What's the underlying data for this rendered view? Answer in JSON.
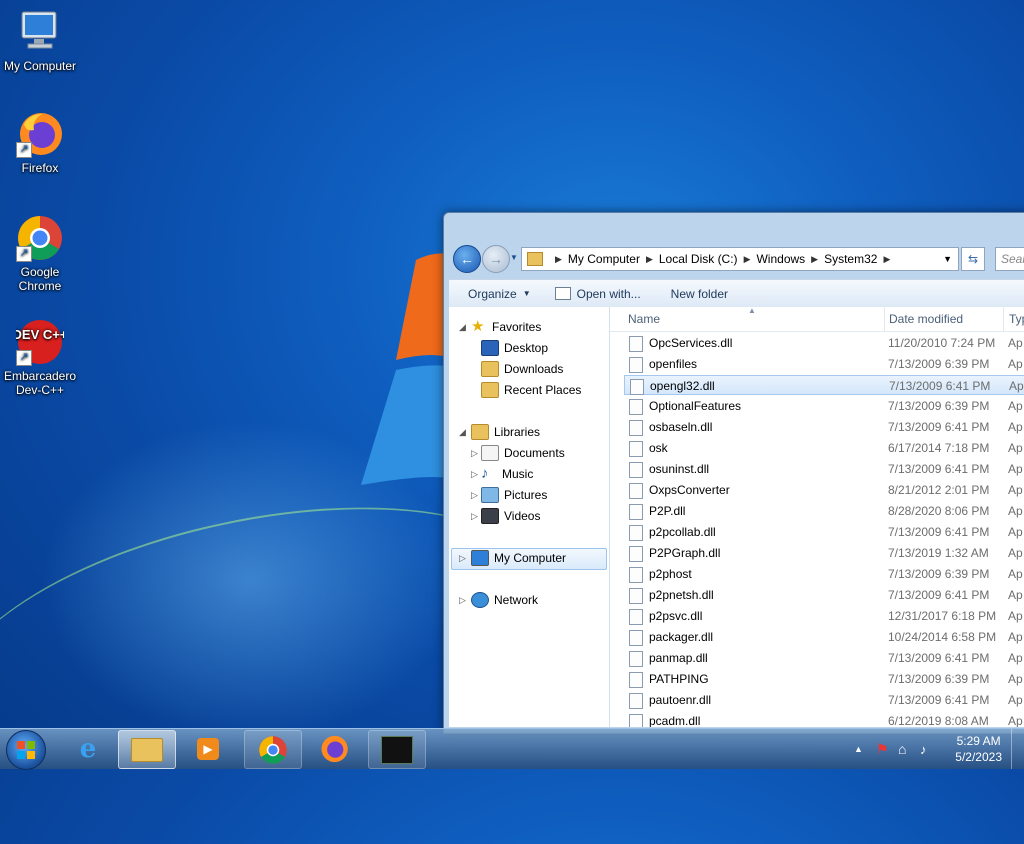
{
  "desktop": {
    "icons": [
      {
        "label": "My Computer"
      },
      {
        "label": "Firefox"
      },
      {
        "label": "Google Chrome"
      },
      {
        "label": "Embarcadero Dev-C++"
      }
    ],
    "devcpp_logo": "DEV C++"
  },
  "explorer": {
    "breadcrumb": [
      "My Computer",
      "Local Disk (C:)",
      "Windows",
      "System32"
    ],
    "search_placeholder": "Sear",
    "toolbar": {
      "organize": "Organize",
      "open_with": "Open with...",
      "new_folder": "New folder"
    },
    "nav": {
      "favorites": "Favorites",
      "desktop": "Desktop",
      "downloads": "Downloads",
      "recent": "Recent Places",
      "libraries": "Libraries",
      "documents": "Documents",
      "music": "Music",
      "pictures": "Pictures",
      "videos": "Videos",
      "my_computer": "My Computer",
      "network": "Network"
    },
    "columns": {
      "name": "Name",
      "date": "Date modified",
      "type": "Typ"
    },
    "files": [
      {
        "name": "OpcServices.dll",
        "date": "11/20/2010 7:24 PM",
        "type": "Ap"
      },
      {
        "name": "openfiles",
        "date": "7/13/2009 6:39 PM",
        "type": "Ap"
      },
      {
        "name": "opengl32.dll",
        "date": "7/13/2009 6:41 PM",
        "type": "Ap"
      },
      {
        "name": "OptionalFeatures",
        "date": "7/13/2009 6:39 PM",
        "type": "Ap"
      },
      {
        "name": "osbaseln.dll",
        "date": "7/13/2009 6:41 PM",
        "type": "Ap"
      },
      {
        "name": "osk",
        "date": "6/17/2014 7:18 PM",
        "type": "Ap"
      },
      {
        "name": "osuninst.dll",
        "date": "7/13/2009 6:41 PM",
        "type": "Ap"
      },
      {
        "name": "OxpsConverter",
        "date": "8/21/2012 2:01 PM",
        "type": "Ap"
      },
      {
        "name": "P2P.dll",
        "date": "8/28/2020 8:06 PM",
        "type": "Ap"
      },
      {
        "name": "p2pcollab.dll",
        "date": "7/13/2009 6:41 PM",
        "type": "Ap"
      },
      {
        "name": "P2PGraph.dll",
        "date": "7/13/2019 1:32 AM",
        "type": "Ap"
      },
      {
        "name": "p2phost",
        "date": "7/13/2009 6:39 PM",
        "type": "Ap"
      },
      {
        "name": "p2pnetsh.dll",
        "date": "7/13/2009 6:41 PM",
        "type": "Ap"
      },
      {
        "name": "p2psvc.dll",
        "date": "12/31/2017 6:18 PM",
        "type": "Ap"
      },
      {
        "name": "packager.dll",
        "date": "10/24/2014 6:58 PM",
        "type": "Ap"
      },
      {
        "name": "panmap.dll",
        "date": "7/13/2009 6:41 PM",
        "type": "Ap"
      },
      {
        "name": "PATHPING",
        "date": "7/13/2009 6:39 PM",
        "type": "Ap"
      },
      {
        "name": "pautoenr.dll",
        "date": "7/13/2009 6:41 PM",
        "type": "Ap"
      },
      {
        "name": "pcadm.dll",
        "date": "6/12/2019 8:08 AM",
        "type": "Ap"
      }
    ]
  },
  "taskbar": {
    "clock_time": "5:29 AM",
    "clock_date": "5/2/2023"
  }
}
